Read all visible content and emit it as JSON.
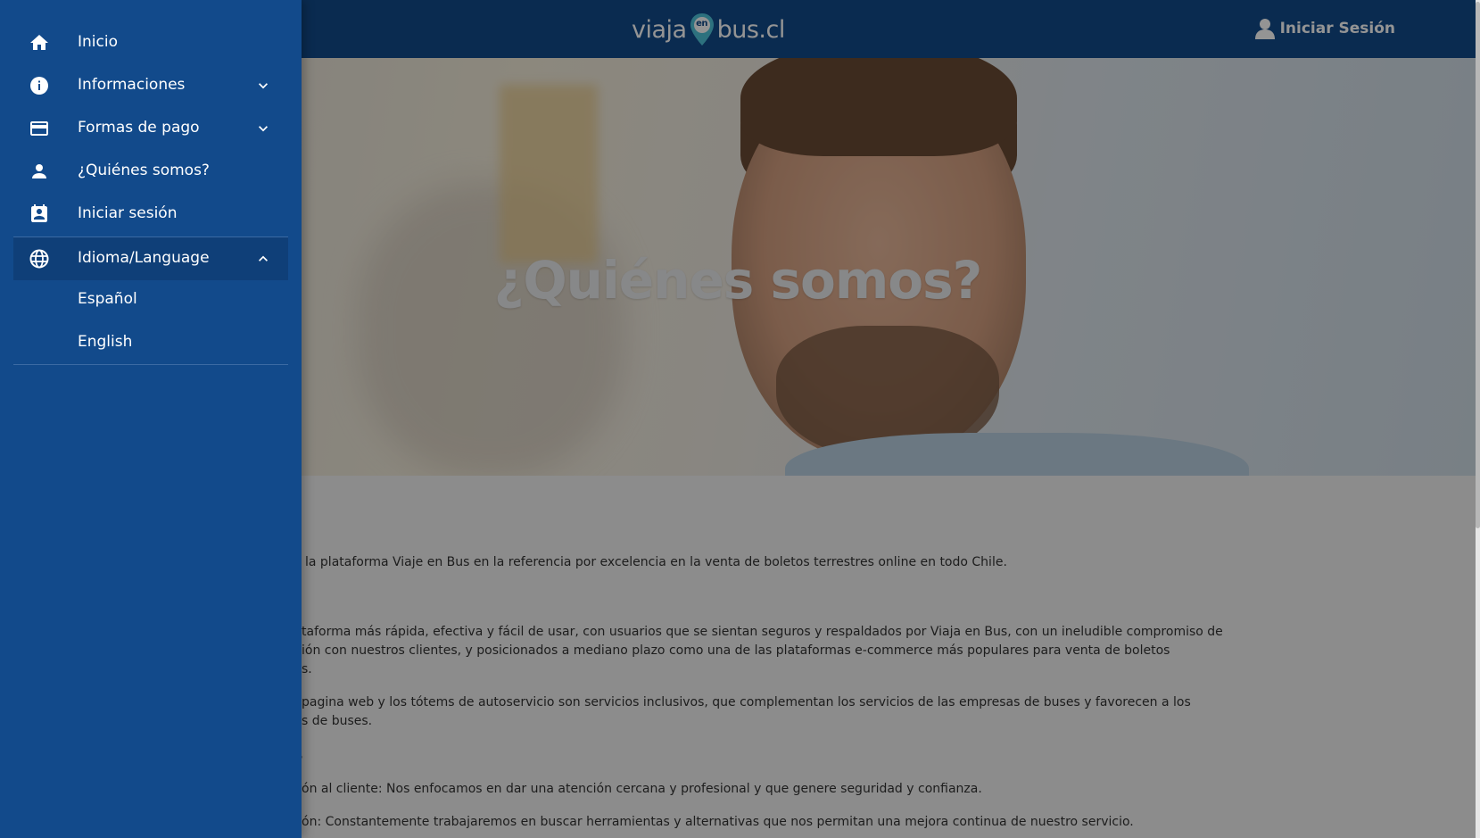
{
  "header": {
    "logo": {
      "left": "viaja",
      "badge": "en",
      "right": "bus.cl"
    },
    "login_label": "Iniciar Sesión"
  },
  "hero": {
    "title": "¿Quiénes somos?"
  },
  "content": {
    "paragraphs": [
      "la plataforma Viaje en Bus en la referencia por excelencia en la venta de boletos terrestres online en todo Chile.",
      "taforma más rápida, efectiva y fácil de usar, con usuarios que se sientan seguros y respaldados por Viaja en Bus, con un ineludible compromiso de",
      "ión con nuestros clientes, y posicionados a mediano plazo como una de las plataformas e-commerce más populares para venta de boletos",
      "s.",
      "pagina web y los tótems de autoservicio son servicios inclusivos, que complementan los servicios de las empresas de buses y favorecen a los",
      "s de buses.",
      "s",
      "ón al cliente: Nos enfocamos en dar una atención cercana y profesional y que genere seguridad y confianza.",
      "ón: Constantemente trabajaremos en buscar herramientas y alternativas que nos permitan una mejora continua de nuestro servicio."
    ]
  },
  "drawer": {
    "items": [
      {
        "label": "Inicio",
        "icon": "home-icon"
      },
      {
        "label": "Informaciones",
        "icon": "info-icon",
        "expandable": true,
        "expanded": false
      },
      {
        "label": "Formas de pago",
        "icon": "credit-card-icon",
        "expandable": true,
        "expanded": false
      },
      {
        "label": "¿Quiénes somos?",
        "icon": "person-icon"
      },
      {
        "label": "Iniciar sesión",
        "icon": "contact-badge-icon"
      },
      {
        "label": "Idioma/Language",
        "icon": "globe-icon",
        "expandable": true,
        "expanded": true
      }
    ],
    "language_options": [
      "Español",
      "English"
    ]
  },
  "colors": {
    "brand_blue": "#124a8b",
    "active_item": "#0f3f78",
    "pin_accent": "#4fc3d9"
  }
}
